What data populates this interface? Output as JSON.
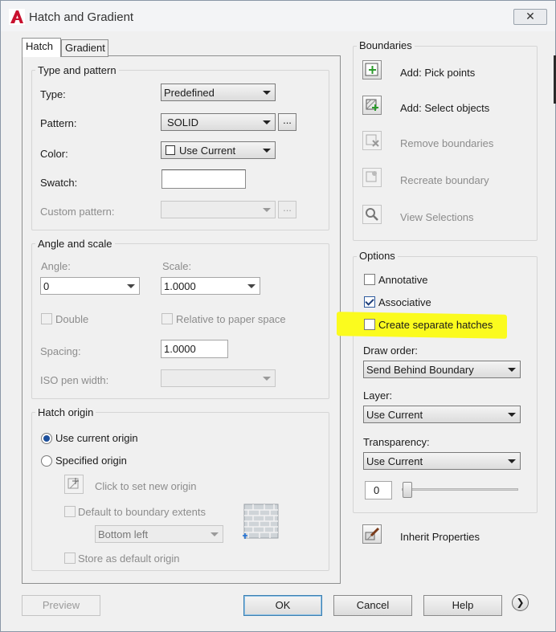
{
  "window": {
    "title": "Hatch and Gradient",
    "close_symbol": "✕"
  },
  "tabs": [
    {
      "label": "Hatch"
    },
    {
      "label": "Gradient"
    }
  ],
  "type_pattern": {
    "group_label": "Type and pattern",
    "type_label": "Type:",
    "type_value": "Predefined",
    "pattern_label": "Pattern:",
    "pattern_value": "SOLID",
    "color_label": "Color:",
    "color_value": "Use Current",
    "swatch_label": "Swatch:",
    "custom_label": "Custom pattern:",
    "dots": "..."
  },
  "angle_scale": {
    "group_label": "Angle and scale",
    "angle_label": "Angle:",
    "angle_value": "0",
    "scale_label": "Scale:",
    "scale_value": "1.0000",
    "double_label": "Double",
    "relative_label": "Relative to paper space",
    "spacing_label": "Spacing:",
    "spacing_value": "1.0000",
    "iso_label": "ISO pen width:"
  },
  "hatch_origin": {
    "group_label": "Hatch origin",
    "use_current_label": "Use current origin",
    "specified_label": "Specified origin",
    "click_label": "Click to set new origin",
    "default_extents_label": "Default to boundary extents",
    "position_value": "Bottom left",
    "store_label": "Store as default origin"
  },
  "boundaries": {
    "group_label": "Boundaries",
    "add_pick": "Add: Pick points",
    "add_select": "Add: Select objects",
    "remove": "Remove boundaries",
    "recreate": "Recreate boundary",
    "view": "View Selections"
  },
  "options": {
    "group_label": "Options",
    "annotative_label": "Annotative",
    "associative_label": "Associative",
    "separate_label": "Create separate hatches",
    "draw_order_label": "Draw order:",
    "draw_order_value": "Send Behind Boundary",
    "layer_label": "Layer:",
    "layer_value": "Use Current",
    "transparency_label": "Transparency:",
    "transparency_value": "Use Current",
    "transparency_amount": "0",
    "transparency_level": 0
  },
  "inherit_label": "Inherit Properties",
  "footer": {
    "preview": "Preview",
    "ok": "OK",
    "cancel": "Cancel",
    "help": "Help",
    "more": "❯"
  },
  "colors": {
    "highlight": "#fbfb1e",
    "acad_red": "#c8102e",
    "accent_blue": "#1c4f9c"
  }
}
